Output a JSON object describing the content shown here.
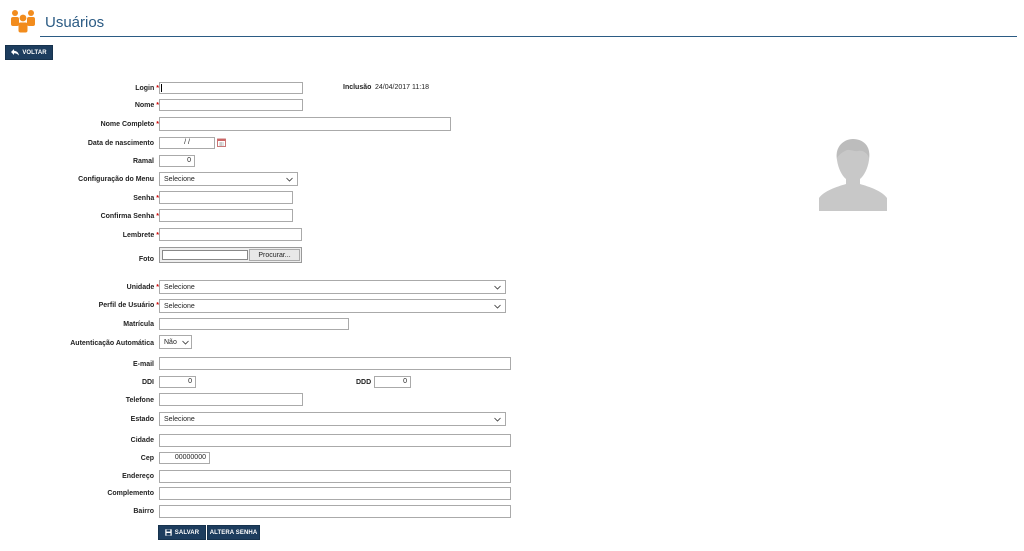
{
  "header": {
    "title": "Usuários",
    "accent": "#f28c1d",
    "rule_color": "#2b5b84"
  },
  "toolbar": {
    "back_label": "VOLTAR"
  },
  "info": {
    "inclusao_label": "Inclusão",
    "inclusao_value": "24/04/2017 11:18"
  },
  "form": {
    "login_label": "Login",
    "nome_label": "Nome",
    "nome_completo_label": "Nome Completo",
    "data_nascimento_label": "Data de nascimento",
    "data_nascimento_value": "/ /",
    "ramal_label": "Ramal",
    "ramal_value": "0",
    "config_menu_label": "Configuração do Menu",
    "config_menu_value": "Selecione",
    "senha_label": "Senha",
    "confirma_senha_label": "Confirma Senha",
    "lembrete_label": "Lembrete",
    "foto_label": "Foto",
    "foto_button": "Procurar...",
    "unidade_label": "Unidade",
    "unidade_value": "Selecione",
    "perfil_label": "Perfil de Usuário",
    "perfil_value": "Selecione",
    "matricula_label": "Matrícula",
    "autenticacao_label": "Autenticação Automática",
    "autenticacao_value": "Não",
    "email_label": "E-mail",
    "ddi_label": "DDI",
    "ddi_value": "0",
    "ddd_label": "DDD",
    "ddd_value": "0",
    "telefone_label": "Telefone",
    "estado_label": "Estado",
    "estado_value": "Selecione",
    "cidade_label": "Cidade",
    "cep_label": "Cep",
    "cep_value": "00000000",
    "endereco_label": "Endereço",
    "complemento_label": "Complemento",
    "bairro_label": "Bairro",
    "required_mark": "*"
  },
  "actions": {
    "save_label": "SALVAR",
    "change_password_label": "ALTERA SENHA"
  }
}
